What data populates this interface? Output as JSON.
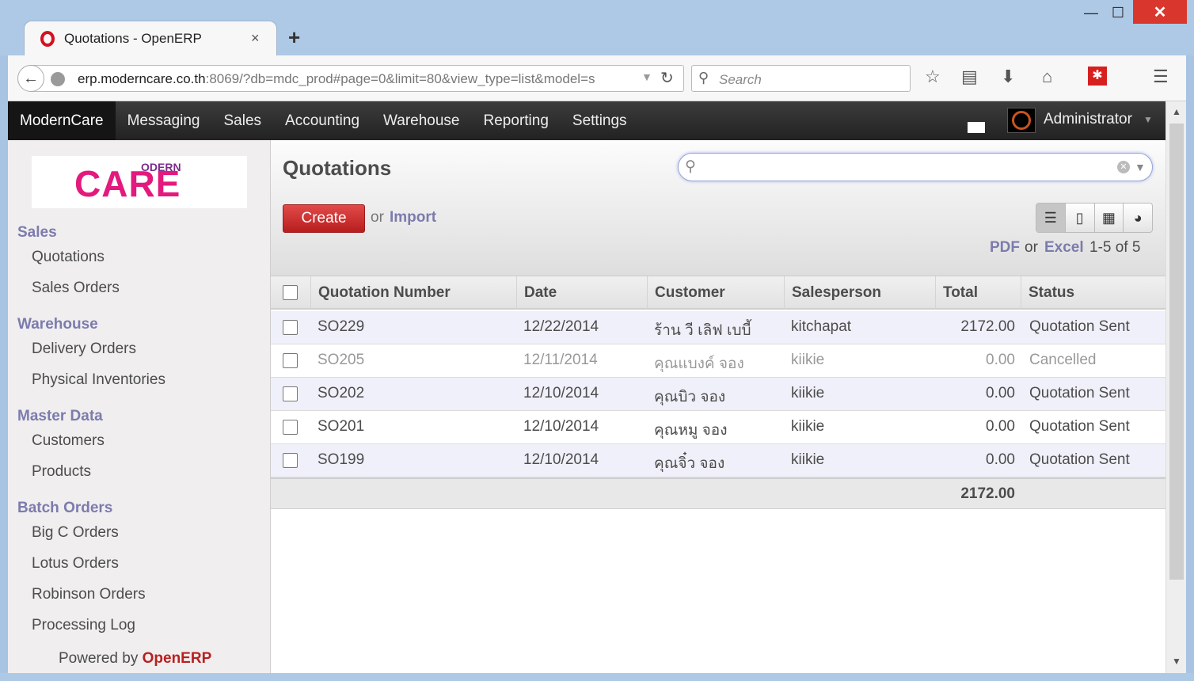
{
  "browser": {
    "tab_title": "Quotations - OpenERP",
    "tab_close": "×",
    "new_tab": "+",
    "url_host": "erp.moderncare.co.th",
    "url_rest": ":8069/?db=mdc_prod#page=0&limit=80&view_type=list&model=s",
    "search_placeholder": "Search"
  },
  "topmenu": {
    "items": [
      "ModernCare",
      "Messaging",
      "Sales",
      "Accounting",
      "Warehouse",
      "Reporting",
      "Settings"
    ],
    "active": "ModernCare",
    "user": "Administrator"
  },
  "sidebar": {
    "logo_main": "CARE",
    "logo_small": "ODERN",
    "sections": [
      {
        "title": "Sales",
        "items": [
          "Quotations",
          "Sales Orders"
        ]
      },
      {
        "title": "Warehouse",
        "items": [
          "Delivery Orders",
          "Physical Inventories"
        ]
      },
      {
        "title": "Master Data",
        "items": [
          "Customers",
          "Products"
        ]
      },
      {
        "title": "Batch Orders",
        "items": [
          "Big C Orders",
          "Lotus Orders",
          "Robinson Orders",
          "Processing Log"
        ]
      }
    ],
    "powered_prefix": "Powered by ",
    "powered_brand": "OpenERP"
  },
  "main": {
    "title": "Quotations",
    "search_value": "",
    "create_label": "Create",
    "or": "or",
    "import_label": "Import",
    "pdf_label": "PDF",
    "excel_label": "Excel",
    "pager": "1-5 of 5"
  },
  "table": {
    "headers": [
      "Quotation Number",
      "Date",
      "Customer",
      "Salesperson",
      "Total",
      "Status"
    ],
    "rows": [
      {
        "number": "SO229",
        "date": "12/22/2014",
        "customer": "ร้าน วี เลิฟ เบบี้",
        "salesperson": "kitchapat",
        "total": "2172.00",
        "status": "Quotation Sent"
      },
      {
        "number": "SO205",
        "date": "12/11/2014",
        "customer": "คุณแบงค์ จอง",
        "salesperson": "kiikie",
        "total": "0.00",
        "status": "Cancelled"
      },
      {
        "number": "SO202",
        "date": "12/10/2014",
        "customer": "คุณบิว จอง",
        "salesperson": "kiikie",
        "total": "0.00",
        "status": "Quotation Sent"
      },
      {
        "number": "SO201",
        "date": "12/10/2014",
        "customer": "คุณหมู จอง",
        "salesperson": "kiikie",
        "total": "0.00",
        "status": "Quotation Sent"
      },
      {
        "number": "SO199",
        "date": "12/10/2014",
        "customer": "คุณจิ๋ว จอง",
        "salesperson": "kiikie",
        "total": "0.00",
        "status": "Quotation Sent"
      }
    ],
    "sum_total": "2172.00"
  },
  "colors": {
    "accent": "#7c7bad",
    "create": "#d12b2b",
    "topbar": "#2c2c2c",
    "brand": "#e4197d"
  }
}
